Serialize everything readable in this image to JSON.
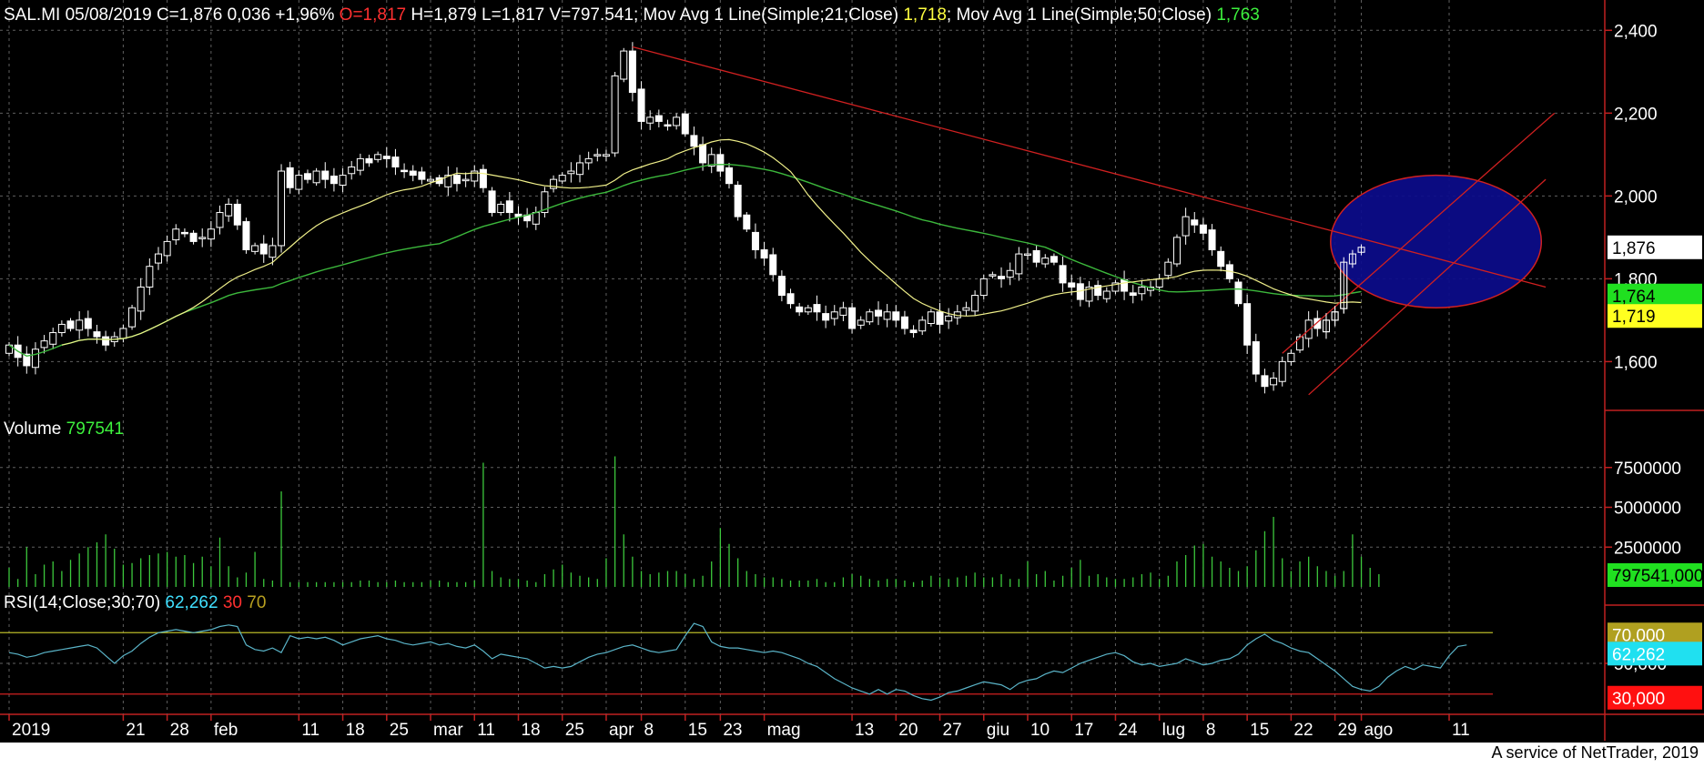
{
  "header": {
    "symbol_line": "SAL.MI 05/08/2019 C=1,876 0,036 +1,96% ",
    "open": "O=1,817",
    "hlv": " H=1,879 L=1,817 V=797.541",
    "sep1": "; Mov Avg 1 Line(Simple;21;Close) ",
    "ma21_value": "1,718",
    "sep2": "; Mov Avg 1 Line(Simple;50;Close) ",
    "ma50_value": "1,763"
  },
  "volume_label": {
    "name": "Volume ",
    "value": "797541"
  },
  "rsi_label": {
    "name": "RSI(14;Close;30;70) ",
    "value": "62,262",
    "low": " 30",
    "high": " 70"
  },
  "footer": "A service of NetTrader, 2019",
  "colors": {
    "background": "#000000",
    "candle": "#ffffff",
    "ma21": "#f0f08a",
    "ma50": "#3cb83c",
    "trendline": "#d02020",
    "ellipse_fill": "#0c0c8c",
    "volume": "#3cc83c",
    "rsi": "#5ab4c8",
    "grid": "#606060"
  },
  "chart_data": [
    {
      "type": "candlestick",
      "title": "SAL.MI",
      "y_ticks": [
        "2,400",
        "2,200",
        "2,000",
        "1,800",
        "1,600"
      ],
      "y_tick_values": [
        2.4,
        2.2,
        2.0,
        1.8,
        1.6
      ],
      "ylim": [
        1.48,
        2.46
      ],
      "x_ticks": [
        "2019",
        "21",
        "28",
        "feb",
        "11",
        "18",
        "25",
        "mar",
        "11",
        "18",
        "25",
        "apr",
        "8",
        "15",
        "23",
        "mag",
        "13",
        "20",
        "27",
        "giu",
        "10",
        "17",
        "24",
        "lug",
        "8",
        "15",
        "22",
        "29",
        "ago",
        "11"
      ],
      "x_tick_index": [
        0,
        13,
        18,
        23,
        33,
        38,
        43,
        48,
        53,
        58,
        63,
        68,
        72,
        77,
        81,
        86,
        96,
        101,
        106,
        111,
        116,
        121,
        126,
        131,
        136,
        141,
        146,
        151,
        154,
        164
      ],
      "close": [
        1.64,
        1.61,
        1.59,
        1.63,
        1.65,
        1.67,
        1.69,
        1.68,
        1.7,
        1.68,
        1.66,
        1.64,
        1.66,
        1.68,
        1.73,
        1.78,
        1.83,
        1.86,
        1.89,
        1.92,
        1.91,
        1.89,
        1.9,
        1.92,
        1.96,
        1.98,
        1.93,
        1.87,
        1.88,
        1.86,
        1.88,
        2.06,
        2.02,
        2.05,
        2.04,
        2.06,
        2.04,
        2.03,
        2.05,
        2.07,
        2.09,
        2.08,
        2.1,
        2.09,
        2.07,
        2.06,
        2.05,
        2.04,
        2.04,
        2.03,
        2.05,
        2.03,
        2.04,
        2.06,
        2.02,
        1.96,
        1.98,
        1.96,
        1.95,
        1.94,
        1.96,
        2.01,
        2.04,
        2.05,
        2.06,
        2.08,
        2.09,
        2.1,
        2.1,
        2.29,
        2.35,
        2.25,
        2.18,
        2.19,
        2.18,
        2.17,
        2.19,
        2.15,
        2.12,
        2.08,
        2.1,
        2.06,
        2.03,
        1.95,
        1.92,
        1.87,
        1.85,
        1.81,
        1.76,
        1.74,
        1.72,
        1.73,
        1.72,
        1.7,
        1.72,
        1.73,
        1.68,
        1.7,
        1.72,
        1.71,
        1.72,
        1.7,
        1.68,
        1.67,
        1.7,
        1.72,
        1.69,
        1.71,
        1.72,
        1.73,
        1.76,
        1.8,
        1.81,
        1.8,
        1.82,
        1.86,
        1.86,
        1.84,
        1.85,
        1.84,
        1.79,
        1.78,
        1.75,
        1.78,
        1.76,
        1.77,
        1.79,
        1.77,
        1.76,
        1.78,
        1.78,
        1.8,
        1.84,
        1.9,
        1.95,
        1.93,
        1.91,
        1.87,
        1.83,
        1.8,
        1.74,
        1.64,
        1.57,
        1.54,
        1.56,
        1.6,
        1.62,
        1.66,
        1.7,
        1.68,
        1.7,
        1.72,
        1.84,
        1.86,
        1.876
      ],
      "last_price_label": "1,876",
      "ma21_label": "1,764",
      "ma50_label": "1,719",
      "ma21_last": 1.764,
      "ma50_last": 1.719,
      "trendlines": [
        {
          "from": [
            71,
            2.36
          ],
          "to": [
            175,
            1.78
          ]
        },
        {
          "from": [
            148,
            1.52
          ],
          "to": [
            175,
            2.04
          ]
        },
        {
          "from": [
            145,
            1.62
          ],
          "to": [
            176,
            2.2
          ]
        }
      ],
      "ellipse": {
        "cx": 162.5,
        "cy": 1.89,
        "rx": 12.0,
        "ry": 0.16
      }
    },
    {
      "type": "bar",
      "title": "Volume",
      "y_ticks": [
        "7500000",
        "5000000",
        "2500000"
      ],
      "y_tick_values": [
        7500000,
        5000000,
        2500000
      ],
      "ylim": [
        0,
        10000000
      ],
      "last_label": "797541,000",
      "values": [
        1.2,
        0.5,
        2.5,
        0.8,
        1.4,
        1.6,
        1.0,
        1.7,
        2.1,
        2.5,
        2.8,
        3.3,
        2.4,
        1.4,
        1.5,
        1.8,
        2.0,
        2.1,
        2.2,
        1.9,
        2.0,
        1.5,
        1.9,
        1.3,
        3.1,
        1.3,
        0.6,
        0.9,
        2.2,
        0.5,
        0.4,
        6.0,
        0.3,
        0.3,
        0.3,
        0.3,
        0.3,
        0.3,
        0.3,
        0.3,
        0.4,
        0.4,
        0.3,
        0.3,
        0.4,
        0.3,
        0.3,
        0.3,
        0.4,
        0.4,
        0.3,
        0.3,
        0.3,
        0.4,
        7.8,
        1.0,
        0.6,
        0.5,
        0.5,
        0.4,
        0.3,
        0.8,
        1.1,
        1.4,
        0.9,
        0.7,
        0.6,
        0.5,
        1.8,
        8.2,
        3.3,
        1.9,
        1.0,
        0.8,
        0.9,
        1.0,
        1.0,
        0.8,
        0.5,
        0.7,
        1.6,
        3.7,
        2.7,
        1.8,
        1.0,
        0.8,
        0.6,
        0.6,
        0.5,
        0.4,
        0.4,
        0.4,
        0.5,
        0.3,
        0.3,
        0.6,
        0.8,
        0.7,
        0.5,
        0.4,
        0.5,
        0.5,
        0.4,
        0.3,
        0.4,
        0.7,
        0.6,
        0.5,
        0.6,
        0.7,
        0.9,
        0.6,
        0.6,
        0.8,
        0.5,
        0.5,
        1.6,
        0.8,
        1.0,
        0.4,
        0.7,
        1.2,
        1.7,
        0.7,
        0.8,
        0.6,
        0.5,
        0.5,
        0.6,
        0.8,
        0.9,
        0.5,
        0.7,
        1.6,
        2.0,
        2.6,
        2.7,
        1.9,
        1.6,
        1.2,
        1.0,
        1.3,
        2.3,
        3.5,
        4.4,
        1.8,
        1.0,
        1.6,
        1.9,
        1.3,
        1.0,
        0.7,
        1.0,
        3.3,
        1.9,
        1.2,
        0.8
      ]
    },
    {
      "type": "line",
      "title": "RSI(14;Close;30;70)",
      "y_ticks": [
        "50,000"
      ],
      "y_tick_values": [
        50
      ],
      "ylim": [
        18,
        82
      ],
      "levels": [
        30,
        70
      ],
      "labels": [
        "70,000",
        "62,262",
        "30,000"
      ],
      "values": [
        57,
        56,
        54,
        55,
        57,
        58,
        59,
        60,
        61,
        62,
        60,
        55,
        50,
        55,
        58,
        63,
        67,
        70,
        71,
        72,
        71,
        70,
        71,
        72,
        74,
        75,
        74,
        62,
        59,
        58,
        60,
        57,
        68,
        66,
        67,
        66,
        67,
        65,
        62,
        64,
        66,
        67,
        68,
        66,
        65,
        63,
        62,
        63,
        64,
        62,
        63,
        61,
        60,
        62,
        58,
        53,
        56,
        55,
        54,
        53,
        50,
        47,
        48,
        47,
        48,
        51,
        54,
        56,
        57,
        59,
        61,
        62,
        60,
        58,
        57,
        58,
        59,
        68,
        76,
        74,
        64,
        61,
        60,
        60,
        59,
        58,
        57,
        58,
        57,
        55,
        53,
        50,
        48,
        44,
        40,
        37,
        34,
        32,
        30,
        33,
        30,
        33,
        32,
        29,
        27,
        26,
        28,
        31,
        32,
        34,
        36,
        38,
        37,
        36,
        33,
        37,
        39,
        40,
        43,
        45,
        44,
        47,
        50,
        52,
        54,
        56,
        57,
        55,
        51,
        49,
        50,
        48,
        49,
        50,
        53,
        51,
        49,
        50,
        52,
        53,
        56,
        62,
        66,
        69,
        65,
        63,
        60,
        58,
        57,
        53,
        49,
        45,
        40,
        35,
        33,
        32,
        35,
        41,
        45,
        48,
        46,
        49,
        48,
        47,
        55,
        61,
        62
      ]
    }
  ]
}
